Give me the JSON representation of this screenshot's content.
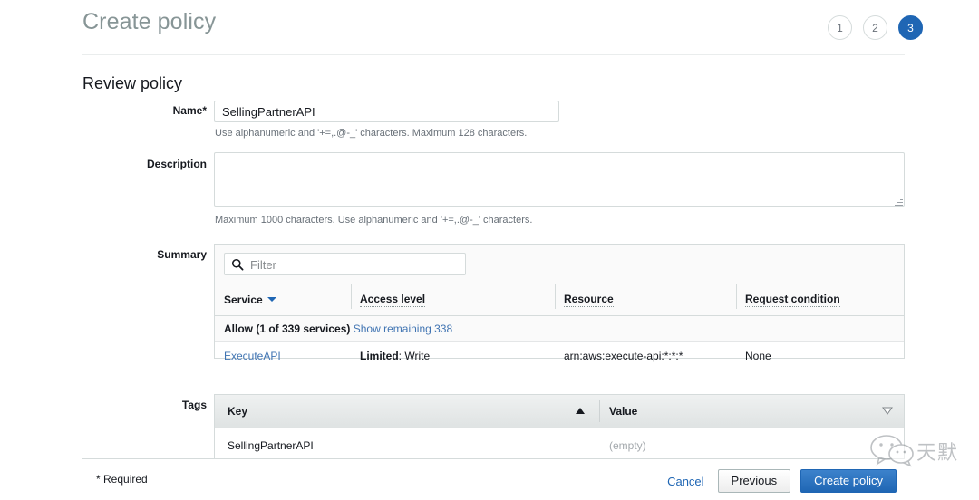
{
  "header": {
    "title": "Create policy",
    "steps": [
      {
        "label": "1",
        "active": false
      },
      {
        "label": "2",
        "active": false
      },
      {
        "label": "3",
        "active": true
      }
    ]
  },
  "section": {
    "title": "Review policy"
  },
  "form": {
    "name": {
      "label": "Name",
      "required_marker": "*",
      "value": "SellingPartnerAPI",
      "placeholder": "",
      "help": "Use alphanumeric and '+=,.@-_' characters. Maximum 128 characters."
    },
    "description": {
      "label": "Description",
      "value": "",
      "placeholder": "",
      "help": "Maximum 1000 characters. Use alphanumeric and '+=,.@-_' characters."
    }
  },
  "summary": {
    "label": "Summary",
    "filter": {
      "placeholder": "Filter",
      "value": "",
      "icon": "search-icon"
    },
    "columns": [
      {
        "label": "Service",
        "sorted": true,
        "sort_icon": "caret-down-icon"
      },
      {
        "label": "Access level",
        "sorted": false
      },
      {
        "label": "Resource",
        "sorted": false
      },
      {
        "label": "Request condition",
        "sorted": false
      }
    ],
    "group_row": {
      "effect": "Allow (1 of 339 services)",
      "link": "Show remaining 338"
    },
    "rows": [
      {
        "service": "ExecuteAPI",
        "access_level_label": "Limited",
        "access_level_value": "Write",
        "resource": "arn:aws:execute-api:*:*:*",
        "request_condition": "None"
      }
    ]
  },
  "tags": {
    "label": "Tags",
    "columns": [
      {
        "label": "Key",
        "sort_icon": "triangle-up-icon"
      },
      {
        "label": "Value",
        "sort_icon": "triangle-down-outline-icon"
      }
    ],
    "rows": [
      {
        "key": "SellingPartnerAPI",
        "value": "(empty)"
      }
    ]
  },
  "footer": {
    "required_note": "* Required",
    "cancel_label": "Cancel",
    "previous_label": "Previous",
    "create_label": "Create policy"
  },
  "watermark": {
    "text": "天默",
    "icon": "wechat-icon"
  },
  "colors": {
    "accent_blue": "#1f66b4",
    "link_blue": "#4074b2",
    "border": "#d5dbdb",
    "muted_text": "#687078",
    "title_gray": "#879596"
  }
}
